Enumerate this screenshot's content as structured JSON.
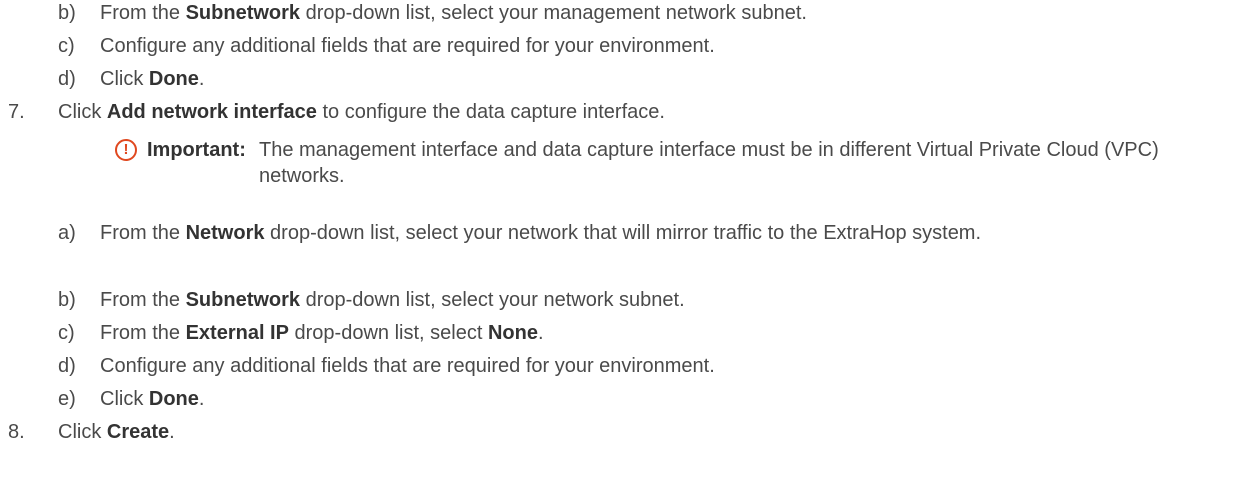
{
  "steps": [
    {
      "marker": "b)",
      "pre": "From the ",
      "bold": "Subnetwork",
      "post": " drop-down list, select your management network subnet."
    },
    {
      "marker": "c)",
      "pre": "Configure any additional fields that are required for your environment.",
      "bold": "",
      "post": ""
    },
    {
      "marker": "d)",
      "pre": "Click ",
      "bold": "Done",
      "post": "."
    },
    {
      "marker": "7.",
      "pre": "Click ",
      "bold": "Add network interface",
      "post": " to configure the data capture interface."
    }
  ],
  "note": {
    "icon": "important-icon",
    "glyph": "!",
    "label": "Important:",
    "text": "The management interface and data capture interface must be in different Virtual Private Cloud (VPC) networks."
  },
  "substeps": [
    {
      "marker": "a)",
      "pre": "From the ",
      "bold": "Network",
      "mid": " drop-down list, select your network that will mirror traffic to the ExtraHop system.",
      "bold2": "",
      "post": ""
    },
    {
      "marker": "b)",
      "pre": "From the ",
      "bold": "Subnetwork",
      "mid": " drop-down list, select your network subnet.",
      "bold2": "",
      "post": ""
    },
    {
      "marker": "c)",
      "pre": "From the ",
      "bold": "External IP",
      "mid": " drop-down list, select ",
      "bold2": "None",
      "post": "."
    },
    {
      "marker": "d)",
      "pre": "Configure any additional fields that are required for your environment.",
      "bold": "",
      "mid": "",
      "bold2": "",
      "post": ""
    },
    {
      "marker": "e)",
      "pre": "Click ",
      "bold": "Done",
      "mid": "",
      "bold2": "",
      "post": "."
    }
  ],
  "final_step": {
    "marker": "8.",
    "pre": "Click ",
    "bold": "Create",
    "post": "."
  },
  "colors": {
    "text": "#4a4a4a",
    "bold": "#333333",
    "important_accent": "#e0481f"
  }
}
